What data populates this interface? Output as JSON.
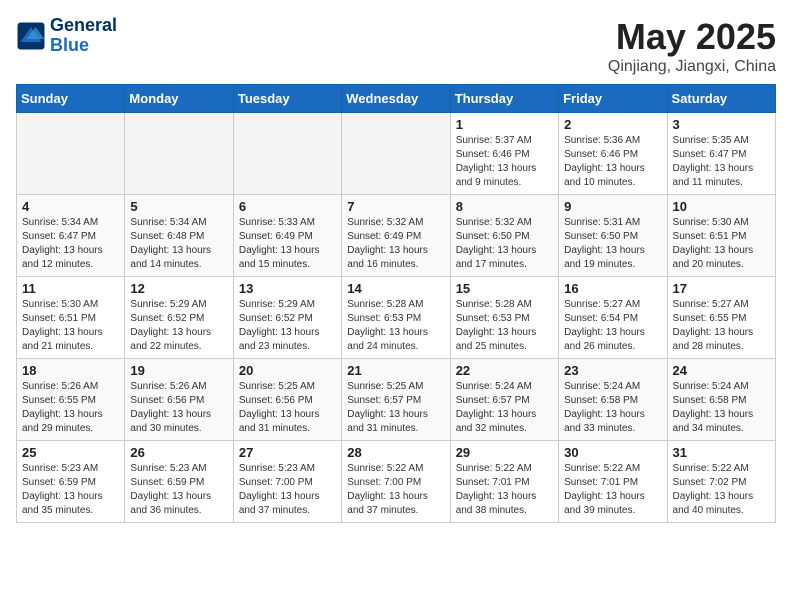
{
  "header": {
    "logo_line1": "General",
    "logo_line2": "Blue",
    "month_title": "May 2025",
    "location": "Qinjiang, Jiangxi, China"
  },
  "weekdays": [
    "Sunday",
    "Monday",
    "Tuesday",
    "Wednesday",
    "Thursday",
    "Friday",
    "Saturday"
  ],
  "weeks": [
    [
      {
        "day": "",
        "info": ""
      },
      {
        "day": "",
        "info": ""
      },
      {
        "day": "",
        "info": ""
      },
      {
        "day": "",
        "info": ""
      },
      {
        "day": "1",
        "info": "Sunrise: 5:37 AM\nSunset: 6:46 PM\nDaylight: 13 hours\nand 9 minutes."
      },
      {
        "day": "2",
        "info": "Sunrise: 5:36 AM\nSunset: 6:46 PM\nDaylight: 13 hours\nand 10 minutes."
      },
      {
        "day": "3",
        "info": "Sunrise: 5:35 AM\nSunset: 6:47 PM\nDaylight: 13 hours\nand 11 minutes."
      }
    ],
    [
      {
        "day": "4",
        "info": "Sunrise: 5:34 AM\nSunset: 6:47 PM\nDaylight: 13 hours\nand 12 minutes."
      },
      {
        "day": "5",
        "info": "Sunrise: 5:34 AM\nSunset: 6:48 PM\nDaylight: 13 hours\nand 14 minutes."
      },
      {
        "day": "6",
        "info": "Sunrise: 5:33 AM\nSunset: 6:49 PM\nDaylight: 13 hours\nand 15 minutes."
      },
      {
        "day": "7",
        "info": "Sunrise: 5:32 AM\nSunset: 6:49 PM\nDaylight: 13 hours\nand 16 minutes."
      },
      {
        "day": "8",
        "info": "Sunrise: 5:32 AM\nSunset: 6:50 PM\nDaylight: 13 hours\nand 17 minutes."
      },
      {
        "day": "9",
        "info": "Sunrise: 5:31 AM\nSunset: 6:50 PM\nDaylight: 13 hours\nand 19 minutes."
      },
      {
        "day": "10",
        "info": "Sunrise: 5:30 AM\nSunset: 6:51 PM\nDaylight: 13 hours\nand 20 minutes."
      }
    ],
    [
      {
        "day": "11",
        "info": "Sunrise: 5:30 AM\nSunset: 6:51 PM\nDaylight: 13 hours\nand 21 minutes."
      },
      {
        "day": "12",
        "info": "Sunrise: 5:29 AM\nSunset: 6:52 PM\nDaylight: 13 hours\nand 22 minutes."
      },
      {
        "day": "13",
        "info": "Sunrise: 5:29 AM\nSunset: 6:52 PM\nDaylight: 13 hours\nand 23 minutes."
      },
      {
        "day": "14",
        "info": "Sunrise: 5:28 AM\nSunset: 6:53 PM\nDaylight: 13 hours\nand 24 minutes."
      },
      {
        "day": "15",
        "info": "Sunrise: 5:28 AM\nSunset: 6:53 PM\nDaylight: 13 hours\nand 25 minutes."
      },
      {
        "day": "16",
        "info": "Sunrise: 5:27 AM\nSunset: 6:54 PM\nDaylight: 13 hours\nand 26 minutes."
      },
      {
        "day": "17",
        "info": "Sunrise: 5:27 AM\nSunset: 6:55 PM\nDaylight: 13 hours\nand 28 minutes."
      }
    ],
    [
      {
        "day": "18",
        "info": "Sunrise: 5:26 AM\nSunset: 6:55 PM\nDaylight: 13 hours\nand 29 minutes."
      },
      {
        "day": "19",
        "info": "Sunrise: 5:26 AM\nSunset: 6:56 PM\nDaylight: 13 hours\nand 30 minutes."
      },
      {
        "day": "20",
        "info": "Sunrise: 5:25 AM\nSunset: 6:56 PM\nDaylight: 13 hours\nand 31 minutes."
      },
      {
        "day": "21",
        "info": "Sunrise: 5:25 AM\nSunset: 6:57 PM\nDaylight: 13 hours\nand 31 minutes."
      },
      {
        "day": "22",
        "info": "Sunrise: 5:24 AM\nSunset: 6:57 PM\nDaylight: 13 hours\nand 32 minutes."
      },
      {
        "day": "23",
        "info": "Sunrise: 5:24 AM\nSunset: 6:58 PM\nDaylight: 13 hours\nand 33 minutes."
      },
      {
        "day": "24",
        "info": "Sunrise: 5:24 AM\nSunset: 6:58 PM\nDaylight: 13 hours\nand 34 minutes."
      }
    ],
    [
      {
        "day": "25",
        "info": "Sunrise: 5:23 AM\nSunset: 6:59 PM\nDaylight: 13 hours\nand 35 minutes."
      },
      {
        "day": "26",
        "info": "Sunrise: 5:23 AM\nSunset: 6:59 PM\nDaylight: 13 hours\nand 36 minutes."
      },
      {
        "day": "27",
        "info": "Sunrise: 5:23 AM\nSunset: 7:00 PM\nDaylight: 13 hours\nand 37 minutes."
      },
      {
        "day": "28",
        "info": "Sunrise: 5:22 AM\nSunset: 7:00 PM\nDaylight: 13 hours\nand 37 minutes."
      },
      {
        "day": "29",
        "info": "Sunrise: 5:22 AM\nSunset: 7:01 PM\nDaylight: 13 hours\nand 38 minutes."
      },
      {
        "day": "30",
        "info": "Sunrise: 5:22 AM\nSunset: 7:01 PM\nDaylight: 13 hours\nand 39 minutes."
      },
      {
        "day": "31",
        "info": "Sunrise: 5:22 AM\nSunset: 7:02 PM\nDaylight: 13 hours\nand 40 minutes."
      }
    ]
  ]
}
